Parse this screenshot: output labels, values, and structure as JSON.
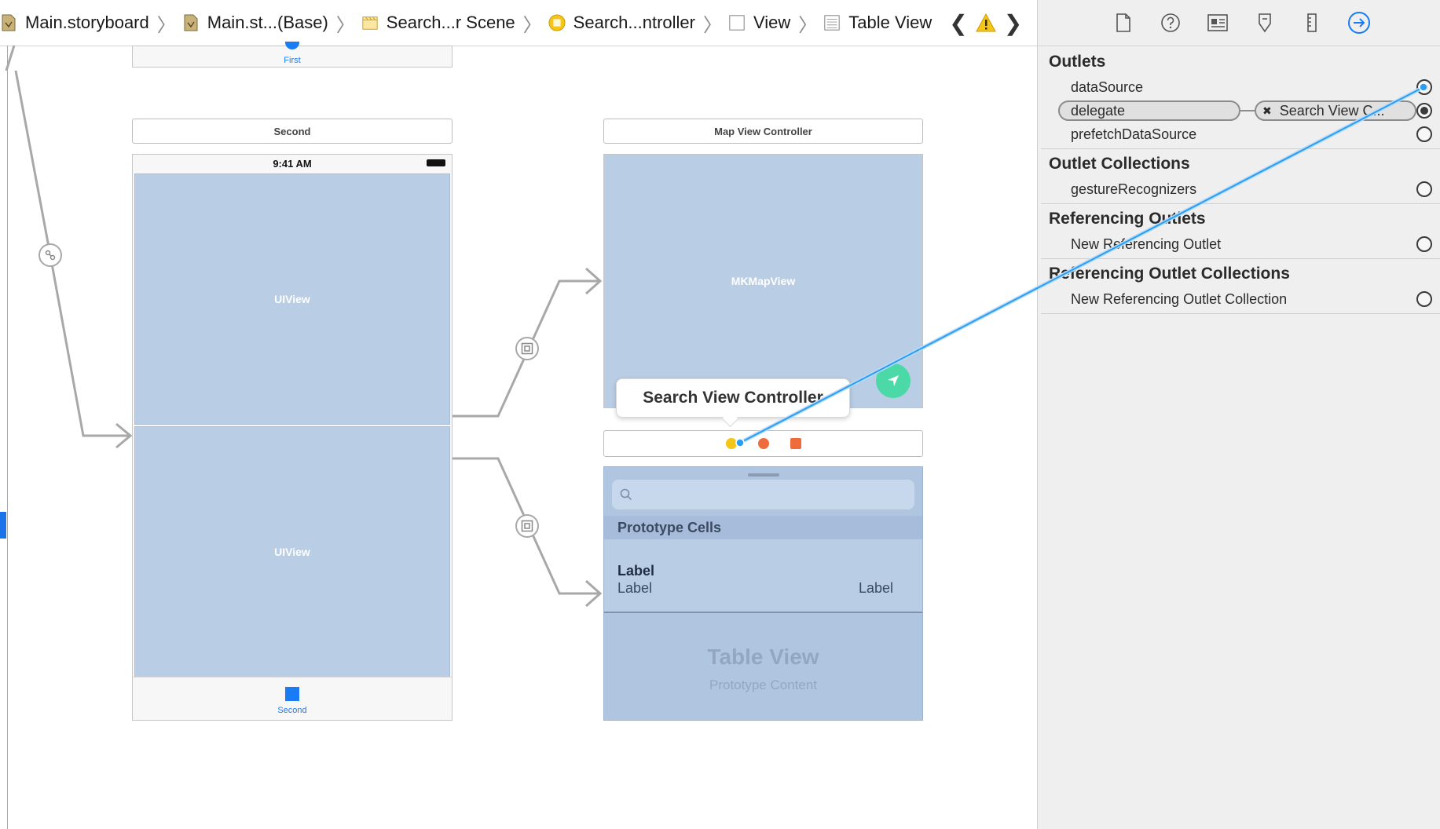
{
  "breadcrumb": {
    "items": [
      "Main.storyboard",
      "Main.st...(Base)",
      "Search...r Scene",
      "Search...ntroller",
      "View",
      "Table View"
    ]
  },
  "canvas": {
    "first_tab_label": "First",
    "second_header": "Second",
    "status_time": "9:41 AM",
    "top_view_label": "UIView",
    "bottom_view_label": "UIView",
    "second_tab_label": "Second",
    "map_header": "Map View Controller",
    "map_view_label": "MKMapView",
    "tooltip": "Search View Controller",
    "prototype_cells_header": "Prototype Cells",
    "cell_title": "Label",
    "cell_subtitle": "Label",
    "cell_detail": "Label",
    "table_view_title": "Table View",
    "table_view_subtitle": "Prototype Content"
  },
  "inspector": {
    "outlets_title": "Outlets",
    "outlets": [
      {
        "label": "dataSource",
        "connected": true
      },
      {
        "label": "delegate",
        "connected": true,
        "target": "Search View C..."
      },
      {
        "label": "prefetchDataSource",
        "connected": false
      }
    ],
    "outlet_collections_title": "Outlet Collections",
    "outlet_collections": [
      {
        "label": "gestureRecognizers"
      }
    ],
    "referencing_outlets_title": "Referencing Outlets",
    "referencing_outlets": [
      {
        "label": "New Referencing Outlet"
      }
    ],
    "referencing_collections_title": "Referencing Outlet Collections",
    "referencing_collections": [
      {
        "label": "New Referencing Outlet Collection"
      }
    ]
  },
  "colors": {
    "accent": "#1a7cf5",
    "view_blue": "#b9cde5",
    "connection_line": "#2a9df4",
    "warning": "#f5c518",
    "map_button": "#4cd9a8"
  }
}
